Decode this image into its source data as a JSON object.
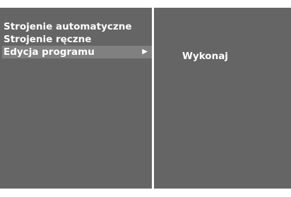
{
  "menu": {
    "items": [
      {
        "label": "Strojenie automatyczne"
      },
      {
        "label": "Strojenie ręczne"
      },
      {
        "label": "Edycja programu",
        "arrow": "▶"
      }
    ]
  },
  "submenu": {
    "action_label": "Wykonaj"
  },
  "colors": {
    "panel_bg": "#656565",
    "selected_bg": "#808080",
    "text": "#ffffff",
    "divider": "#ffffff"
  }
}
